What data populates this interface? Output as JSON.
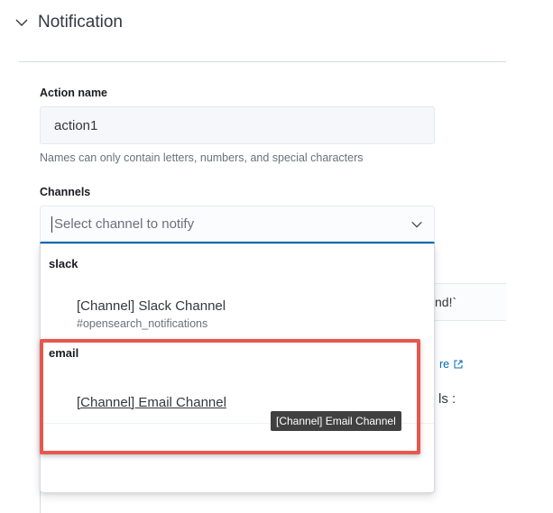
{
  "section": {
    "title": "Notification"
  },
  "form": {
    "action_name_label": "Action name",
    "action_name_value": "action1",
    "action_name_help": "Names can only contain letters, numbers, and special characters",
    "channels_label": "Channels",
    "channels_placeholder": "Select channel to notify"
  },
  "dropdown": {
    "groups": [
      {
        "title": "slack",
        "options": [
          {
            "label": "[Channel] Slack Channel",
            "sublabel": "#opensearch_notifications"
          }
        ]
      },
      {
        "title": "email",
        "options": [
          {
            "label": "[Channel] Email Channel"
          }
        ]
      }
    ]
  },
  "tooltip": {
    "text": "[Channel] Email Channel"
  },
  "background": {
    "partial_text": "nd!`",
    "partial_link": "re",
    "partial_label": "ls :"
  },
  "colors": {
    "accent": "#006bb8",
    "highlight": "#e8574f",
    "tooltip_bg": "#404040"
  }
}
